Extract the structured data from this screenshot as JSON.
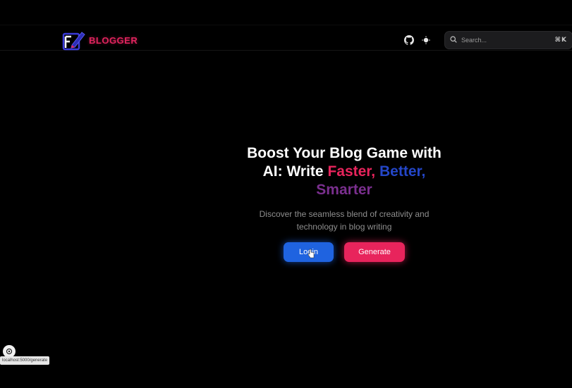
{
  "colors": {
    "background": "#000000",
    "brand_red": "#e8245c",
    "brand_blue": "#1f63e0",
    "better_blue": "#2446c8",
    "smarter_purple": "#7a2f8e"
  },
  "header": {
    "brand": "BLOGGER",
    "logo_icon": "pen-square-logo-icon",
    "github_icon": "github-icon",
    "theme_icon": "sun-icon",
    "search": {
      "placeholder": "Search...",
      "shortcut": "⌘K"
    }
  },
  "hero": {
    "title_line1": "Boost Your Blog Game with",
    "title_line2_prefix": "AI: Write",
    "word_faster": "Faster,",
    "word_better": "Better,",
    "word_smarter": "Smarter",
    "subtitle": "Discover the seamless blend of creativity and technology in blog writing"
  },
  "actions": {
    "login_label": "Login",
    "generate_label": "Generate"
  },
  "status_bar": {
    "url": "localhost:5000/generate"
  }
}
